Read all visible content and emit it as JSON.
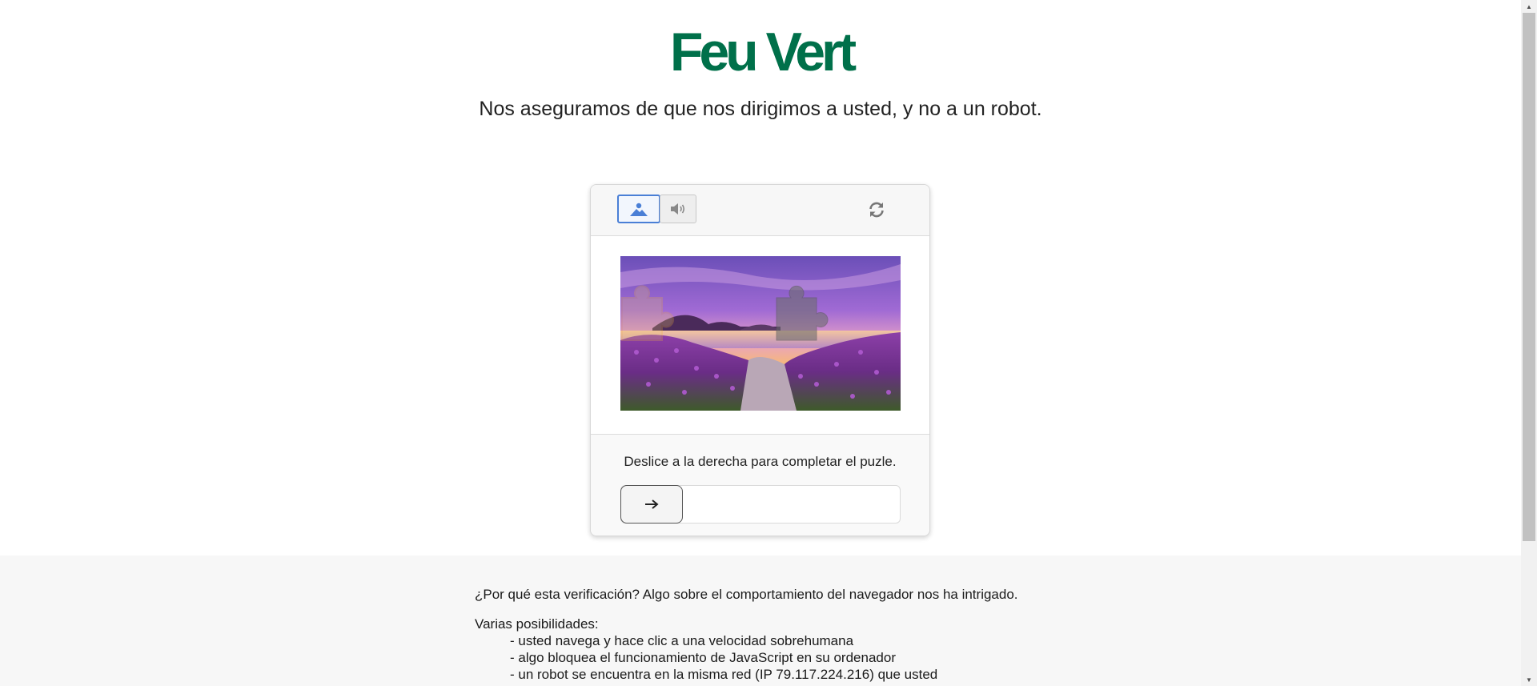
{
  "brand": {
    "logo_text": "Feu Vert",
    "color": "#00704a"
  },
  "headline": "Nos aseguramos de que nos dirigimos a usted, y no a un robot.",
  "captcha": {
    "mode_image_icon": "image-icon",
    "mode_audio_icon": "speaker-icon",
    "refresh_icon": "refresh-icon",
    "instruction": "Deslice a la derecha para completar el puzle.",
    "slider_icon": "arrow-right-icon",
    "slider_progress": 0,
    "accent_color": "#4a7fd6"
  },
  "info": {
    "question": "¿Por qué esta verificación? Algo sobre el comportamiento del navegador nos ha intrigado.",
    "list_title": "Varias posibilidades:",
    "items": [
      "- usted navega y hace clic a una velocidad sobrehumana",
      "- algo bloquea el funcionamiento de JavaScript en su ordenador",
      "- un robot se encuentra en la misma red (IP 79.117.224.216) que usted"
    ]
  }
}
